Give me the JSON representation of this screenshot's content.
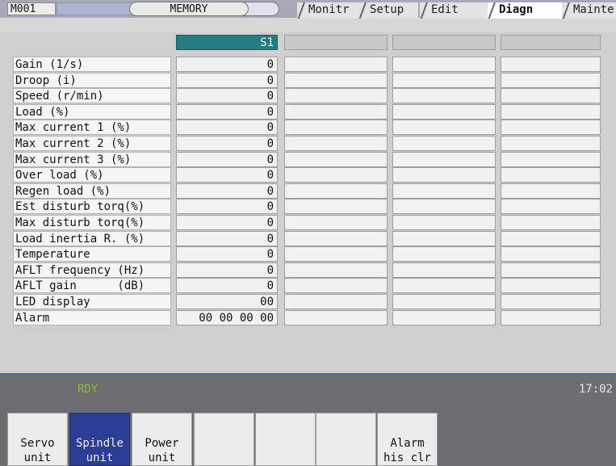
{
  "header": {
    "screen_id": "M001",
    "mode": "MEMORY",
    "tabs": [
      {
        "label": "Monitr",
        "active": false
      },
      {
        "label": "Setup",
        "active": false
      },
      {
        "label": "Edit",
        "active": false
      },
      {
        "label": "Diagn",
        "active": true
      },
      {
        "label": "Mainte",
        "active": false
      }
    ]
  },
  "table": {
    "column_header": "S1",
    "rows": [
      {
        "label": "Gain (1/s)",
        "value": "0"
      },
      {
        "label": "Droop (i)",
        "value": "0"
      },
      {
        "label": "Speed (r/min)",
        "value": "0"
      },
      {
        "label": "Load (%)",
        "value": "0"
      },
      {
        "label": "Max current 1 (%)",
        "value": "0"
      },
      {
        "label": "Max current 2 (%)",
        "value": "0"
      },
      {
        "label": "Max current 3 (%)",
        "value": "0"
      },
      {
        "label": "Over load (%)",
        "value": "0"
      },
      {
        "label": "Regen load (%)",
        "value": "0"
      },
      {
        "label": "Est disturb torq(%)",
        "value": "0"
      },
      {
        "label": "Max disturb torq(%)",
        "value": "0"
      },
      {
        "label": "Load inertia R. (%)",
        "value": "0"
      },
      {
        "label": "Temperature",
        "value": "0"
      },
      {
        "label": "AFLT frequency (Hz)",
        "value": "0"
      },
      {
        "label": "AFLT gain      (dB)",
        "value": "0"
      },
      {
        "label": "LED display",
        "value": "00"
      },
      {
        "label": "Alarm",
        "value": "00 00 00 00"
      }
    ]
  },
  "status": {
    "state": "RDY",
    "clock": "17:02"
  },
  "softkeys": [
    {
      "label": "Servo\nunit",
      "active": false
    },
    {
      "label": "Spindle\nunit",
      "active": true
    },
    {
      "label": "Power\nunit",
      "active": false
    },
    {
      "label": "",
      "active": false
    },
    {
      "label": "",
      "active": false
    },
    {
      "label": "",
      "active": false
    },
    {
      "label": "Alarm\nhis clr",
      "active": false
    }
  ],
  "colors": {
    "accent_header": "#257b80",
    "active_softkey": "#2c3e94",
    "status_rdy": "#8fb24a"
  }
}
